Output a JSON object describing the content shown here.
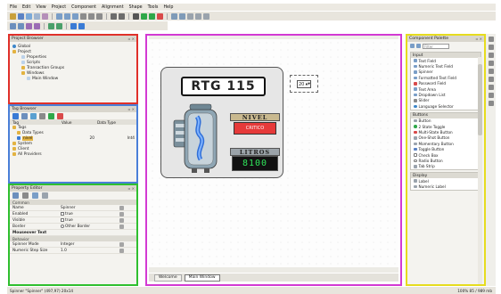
{
  "menubar": [
    "File",
    "Edit",
    "View",
    "Project",
    "Component",
    "Alignment",
    "Shape",
    "Tools",
    "Help"
  ],
  "project_browser": {
    "title": "Project Browser",
    "items": [
      {
        "label": "Global",
        "icon": "globe-icon",
        "level": 0
      },
      {
        "label": "Project",
        "icon": "folder-icon",
        "level": 0
      },
      {
        "label": "Properties",
        "icon": "doc-icon",
        "level": 2
      },
      {
        "label": "Scripts",
        "icon": "doc-icon",
        "level": 2
      },
      {
        "label": "Transaction Groups",
        "icon": "folder-icon",
        "level": 2
      },
      {
        "label": "Windows",
        "icon": "folder-icon",
        "level": 2
      },
      {
        "label": "Main Window",
        "icon": "doc-icon",
        "level": 3
      }
    ]
  },
  "tag_browser": {
    "title": "Tag Browser",
    "columns": [
      "Tag",
      "Value",
      "Data Type"
    ],
    "rows": [
      {
        "tag": "Tags",
        "value": "",
        "type": "",
        "level": 0
      },
      {
        "tag": "Data Types",
        "value": "",
        "type": "",
        "level": 1
      },
      {
        "tag": "nivel",
        "value": "20",
        "type": "Int4",
        "level": 1
      },
      {
        "tag": "System",
        "value": "",
        "type": "",
        "level": 0
      },
      {
        "tag": "Client",
        "value": "",
        "type": "",
        "level": 0
      },
      {
        "tag": "All Providers",
        "value": "",
        "type": "",
        "level": 0
      }
    ]
  },
  "property_editor": {
    "title": "Property Editor",
    "section_common": "Common",
    "rows": [
      {
        "name": "Name",
        "value": "Spinner"
      },
      {
        "name": "Enabled",
        "value": "true"
      },
      {
        "name": "Visible",
        "value": "true"
      },
      {
        "name": "Border",
        "value": "Other Border"
      },
      {
        "name": "Mouseover Text",
        "value": ""
      }
    ],
    "section_behavior": "Behavior",
    "rows2": [
      {
        "name": "Spinner Mode",
        "value": "Integer"
      },
      {
        "name": "Numeric Step Size",
        "value": "1.0"
      }
    ]
  },
  "designer": {
    "window_title": "RTG 115",
    "nivel_label": "NIVEL",
    "nivel_alarm": "CRITICO",
    "litros_label": "LITROS",
    "litros_value": "8100",
    "spinner_value": "20",
    "tabs": [
      "Welcome",
      "Main Window"
    ]
  },
  "component_palette": {
    "title": "Component Palette",
    "search_placeholder": "Filter",
    "groups": [
      {
        "name": "Input",
        "items": [
          "Text Field",
          "Numeric Text Field",
          "Spinner",
          "Formatted Text Field",
          "Password Field",
          "Text Area",
          "Dropdown List",
          "Slider",
          "Language Selector"
        ]
      },
      {
        "name": "Buttons",
        "items": [
          "Button",
          "2 State Toggle",
          "Multi-State Button",
          "One-Shot Button",
          "Momentary Button",
          "Toggle Button",
          "Check Box",
          "Radio Button",
          "Tab Strip"
        ]
      },
      {
        "name": "Display",
        "items": [
          "Label",
          "Numeric Label"
        ]
      }
    ]
  },
  "status": {
    "left": "Spinner \"Spinner\" (497,97) 20x14",
    "right": "100%  85 / 989 mb"
  },
  "colors": {
    "project_border": "#e0302a",
    "tag_border": "#4a7fd8",
    "prop_border": "#2fbf2f",
    "designer_border": "#d33ad3",
    "palette_border": "#e6dc1e"
  }
}
